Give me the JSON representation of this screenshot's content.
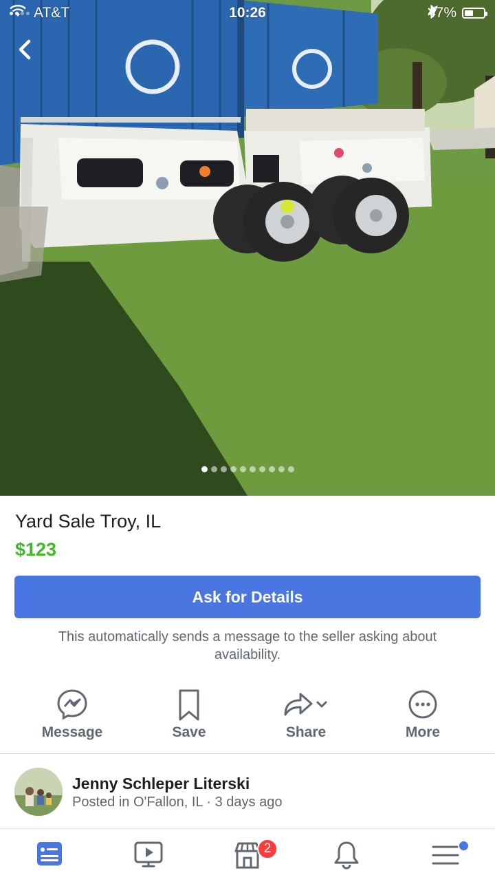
{
  "status_bar": {
    "carrier": "AT&T",
    "time": "10:26",
    "battery": "47%",
    "battery_level": 0.47
  },
  "photo": {
    "description_icons": [
      "back-chevron-icon"
    ],
    "page_count": 10,
    "active_page": 1
  },
  "listing": {
    "title": "Yard Sale Troy, IL",
    "price": "$123",
    "ask_button": "Ask for Details",
    "helper_text": "This automatically sends a message to the seller asking about availability."
  },
  "actions": [
    {
      "label": "Message",
      "icon": "messenger-icon"
    },
    {
      "label": "Save",
      "icon": "bookmark-icon"
    },
    {
      "label": "Share",
      "icon": "share-icon"
    },
    {
      "label": "More",
      "icon": "more-icon"
    }
  ],
  "seller": {
    "name": "Jenny Schleper Literski",
    "meta": "Posted in O'Fallon, IL · 3 days ago"
  },
  "tabbar": {
    "items": [
      "news-feed-icon",
      "watch-icon",
      "marketplace-icon",
      "notifications-icon",
      "menu-icon"
    ],
    "marketplace_badge": "2",
    "active": "news-feed-icon",
    "active_color": "#4a76e2"
  },
  "colors": {
    "accent": "#4a76e2",
    "price": "#42b72a",
    "badge": "#fa3e3e"
  }
}
